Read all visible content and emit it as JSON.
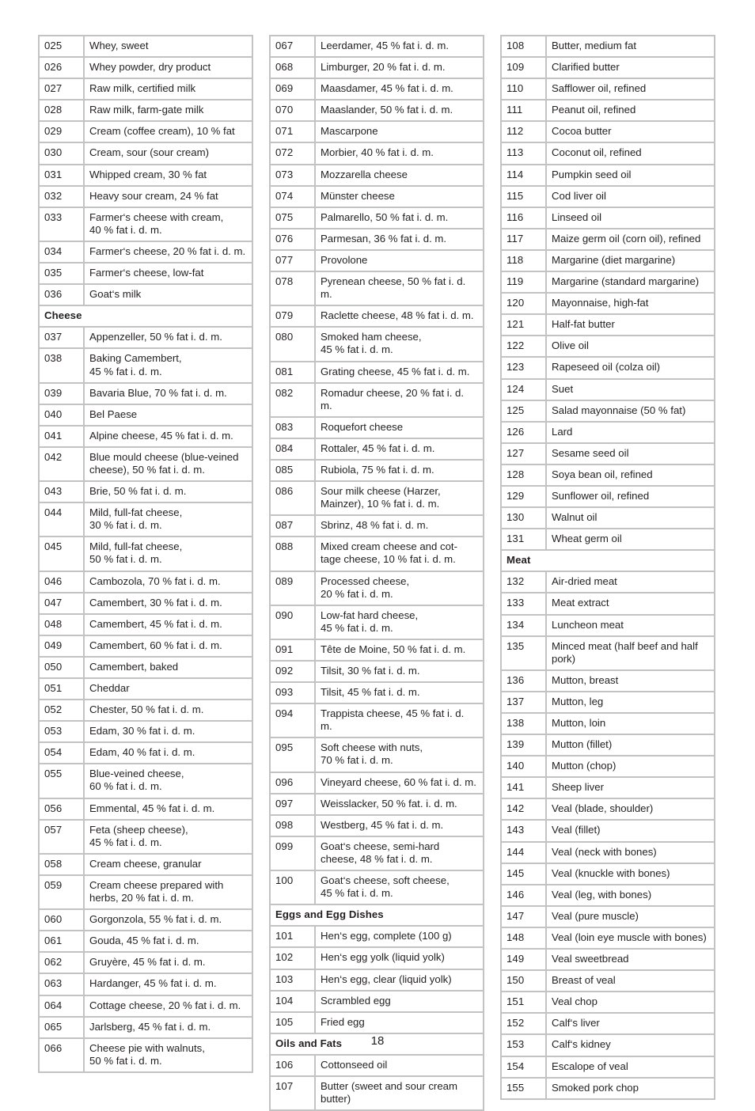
{
  "page": {
    "number": "18",
    "columns": [
      {
        "rows": [
          {
            "type": "item",
            "id": "025",
            "name": "Whey, sweet"
          },
          {
            "type": "item",
            "id": "026",
            "name": "Whey powder, dry product"
          },
          {
            "type": "item",
            "id": "027",
            "name": "Raw milk, certified milk"
          },
          {
            "type": "item",
            "id": "028",
            "name": "Raw milk, farm-gate milk"
          },
          {
            "type": "item",
            "id": "029",
            "name": "Cream (coffee cream), 10 % fat"
          },
          {
            "type": "item",
            "id": "030",
            "name": "Cream, sour (sour cream)"
          },
          {
            "type": "item",
            "id": "031",
            "name": "Whipped cream, 30 % fat"
          },
          {
            "type": "item",
            "id": "032",
            "name": "Heavy sour cream, 24 % fat"
          },
          {
            "type": "item",
            "id": "033",
            "name": "Farmer‘s cheese with cream,\n40 % fat i. d. m."
          },
          {
            "type": "item",
            "id": "034",
            "name": "Farmer‘s cheese, 20 % fat i. d. m."
          },
          {
            "type": "item",
            "id": "035",
            "name": "Farmer‘s cheese, low-fat"
          },
          {
            "type": "item",
            "id": "036",
            "name": "Goat‘s milk"
          },
          {
            "type": "section",
            "name": "Cheese"
          },
          {
            "type": "item",
            "id": "037",
            "name": "Appenzeller, 50 % fat i. d. m."
          },
          {
            "type": "item",
            "id": "038",
            "name": "Baking Camembert,\n45 % fat i. d. m."
          },
          {
            "type": "item",
            "id": "039",
            "name": "Bavaria Blue, 70 % fat i. d. m."
          },
          {
            "type": "item",
            "id": "040",
            "name": "Bel Paese"
          },
          {
            "type": "item",
            "id": "041",
            "name": "Alpine cheese, 45 % fat i. d. m."
          },
          {
            "type": "item",
            "id": "042",
            "name": "Blue mould cheese (blue-veined\ncheese), 50 % fat i. d. m."
          },
          {
            "type": "item",
            "id": "043",
            "name": "Brie, 50 % fat i. d. m."
          },
          {
            "type": "item",
            "id": "044",
            "name": "Mild, full-fat cheese,\n30 % fat i. d. m."
          },
          {
            "type": "item",
            "id": "045",
            "name": "Mild, full-fat cheese,\n50 % fat i. d. m."
          },
          {
            "type": "item",
            "id": "046",
            "name": "Cambozola, 70 % fat i. d. m."
          },
          {
            "type": "item",
            "id": "047",
            "name": "Camembert, 30 % fat i. d. m."
          },
          {
            "type": "item",
            "id": "048",
            "name": "Camembert, 45 % fat i. d. m."
          },
          {
            "type": "item",
            "id": "049",
            "name": "Camembert, 60 % fat i. d. m."
          },
          {
            "type": "item",
            "id": "050",
            "name": "Camembert, baked"
          },
          {
            "type": "item",
            "id": "051",
            "name": "Cheddar"
          },
          {
            "type": "item",
            "id": "052",
            "name": "Chester, 50 % fat i. d. m."
          },
          {
            "type": "item",
            "id": "053",
            "name": "Edam, 30 % fat i. d. m."
          },
          {
            "type": "item",
            "id": "054",
            "name": "Edam, 40 % fat i. d. m."
          },
          {
            "type": "item",
            "id": "055",
            "name": "Blue-veined cheese,\n60 % fat i. d. m."
          },
          {
            "type": "item",
            "id": "056",
            "name": "Emmental, 45 % fat i. d. m."
          },
          {
            "type": "item",
            "id": "057",
            "name": "Feta (sheep cheese),\n45 % fat i. d. m."
          },
          {
            "type": "item",
            "id": "058",
            "name": "Cream cheese, granular"
          },
          {
            "type": "item",
            "id": "059",
            "name": "Cream cheese prepared with\nherbs, 20 % fat i. d. m."
          },
          {
            "type": "item",
            "id": "060",
            "name": "Gorgonzola, 55 % fat i. d. m."
          },
          {
            "type": "item",
            "id": "061",
            "name": "Gouda, 45 % fat i. d. m."
          },
          {
            "type": "item",
            "id": "062",
            "name": "Gruyère, 45 % fat i. d. m."
          },
          {
            "type": "item",
            "id": "063",
            "name": "Hardanger, 45 % fat i. d. m."
          },
          {
            "type": "item",
            "id": "064",
            "name": "Cottage cheese, 20 % fat i. d. m."
          },
          {
            "type": "item",
            "id": "065",
            "name": "Jarlsberg, 45 % fat i. d. m."
          },
          {
            "type": "item",
            "id": "066",
            "name": "Cheese pie with walnuts,\n50 % fat i. d. m."
          }
        ]
      },
      {
        "rows": [
          {
            "type": "item",
            "id": "067",
            "name": "Leerdamer, 45 % fat i. d. m."
          },
          {
            "type": "item",
            "id": "068",
            "name": "Limburger, 20 % fat i. d. m."
          },
          {
            "type": "item",
            "id": "069",
            "name": "Maasdamer, 45 % fat i. d. m."
          },
          {
            "type": "item",
            "id": "070",
            "name": "Maaslander, 50 % fat i. d. m."
          },
          {
            "type": "item",
            "id": "071",
            "name": "Mascarpone"
          },
          {
            "type": "item",
            "id": "072",
            "name": "Morbier, 40 % fat i. d. m."
          },
          {
            "type": "item",
            "id": "073",
            "name": "Mozzarella cheese"
          },
          {
            "type": "item",
            "id": "074",
            "name": "Münster cheese"
          },
          {
            "type": "item",
            "id": "075",
            "name": "Palmarello, 50 % fat i. d. m."
          },
          {
            "type": "item",
            "id": "076",
            "name": "Parmesan, 36 % fat i. d. m."
          },
          {
            "type": "item",
            "id": "077",
            "name": "Provolone"
          },
          {
            "type": "item",
            "id": "078",
            "name": "Pyrenean cheese, 50 % fat i. d. m."
          },
          {
            "type": "item",
            "id": "079",
            "name": "Raclette cheese, 48 % fat i. d. m."
          },
          {
            "type": "item",
            "id": "080",
            "name": "Smoked ham cheese,\n45 % fat i. d. m."
          },
          {
            "type": "item",
            "id": "081",
            "name": "Grating cheese, 45 % fat i. d. m."
          },
          {
            "type": "item",
            "id": "082",
            "name": "Romadur cheese, 20 % fat i. d. m."
          },
          {
            "type": "item",
            "id": "083",
            "name": "Roquefort cheese"
          },
          {
            "type": "item",
            "id": "084",
            "name": "Rottaler, 45 % fat i. d. m."
          },
          {
            "type": "item",
            "id": "085",
            "name": "Rubiola, 75 % fat i. d. m."
          },
          {
            "type": "item",
            "id": "086",
            "name": "Sour milk cheese (Harzer,\nMainzer), 10 % fat i. d. m."
          },
          {
            "type": "item",
            "id": "087",
            "name": "Sbrinz, 48 % fat i. d. m."
          },
          {
            "type": "item",
            "id": "088",
            "name": "Mixed cream cheese and cot-\ntage cheese, 10 % fat i. d. m."
          },
          {
            "type": "item",
            "id": "089",
            "name": "Processed cheese,\n20 % fat i. d. m."
          },
          {
            "type": "item",
            "id": "090",
            "name": "Low-fat hard cheese,\n45 % fat i. d. m."
          },
          {
            "type": "item",
            "id": "091",
            "name": "Tête de Moine, 50 % fat i. d. m."
          },
          {
            "type": "item",
            "id": "092",
            "name": "Tilsit, 30 % fat i. d. m."
          },
          {
            "type": "item",
            "id": "093",
            "name": "Tilsit, 45 % fat i. d. m."
          },
          {
            "type": "item",
            "id": "094",
            "name": "Trappista cheese, 45 % fat i. d. m."
          },
          {
            "type": "item",
            "id": "095",
            "name": "Soft cheese with nuts,\n70 % fat i. d. m."
          },
          {
            "type": "item",
            "id": "096",
            "name": "Vineyard cheese, 60 % fat i. d. m."
          },
          {
            "type": "item",
            "id": "097",
            "name": "Weisslacker, 50 % fat. i. d. m."
          },
          {
            "type": "item",
            "id": "098",
            "name": "Westberg, 45 % fat i. d. m."
          },
          {
            "type": "item",
            "id": "099",
            "name": "Goat‘s cheese, semi-hard\ncheese, 48 % fat i. d. m."
          },
          {
            "type": "item",
            "id": "100",
            "name": "Goat‘s cheese, soft cheese,\n45 % fat i. d. m."
          },
          {
            "type": "section",
            "name": "Eggs and Egg Dishes"
          },
          {
            "type": "item",
            "id": "101",
            "name": "Hen‘s egg, complete (100 g)"
          },
          {
            "type": "item",
            "id": "102",
            "name": "Hen‘s egg yolk (liquid yolk)"
          },
          {
            "type": "item",
            "id": "103",
            "name": "Hen‘s egg, clear (liquid yolk)"
          },
          {
            "type": "item",
            "id": "104",
            "name": "Scrambled egg"
          },
          {
            "type": "item",
            "id": "105",
            "name": "Fried egg"
          },
          {
            "type": "section",
            "name": "Oils and Fats"
          },
          {
            "type": "item",
            "id": "106",
            "name": "Cottonseed oil"
          },
          {
            "type": "item",
            "id": "107",
            "name": "Butter (sweet and sour cream\nbutter)"
          }
        ]
      },
      {
        "rows": [
          {
            "type": "item",
            "id": "108",
            "name": "Butter, medium fat"
          },
          {
            "type": "item",
            "id": "109",
            "name": "Clarified butter"
          },
          {
            "type": "item",
            "id": "110",
            "name": "Safflower oil, refined"
          },
          {
            "type": "item",
            "id": "111",
            "name": "Peanut oil, refined"
          },
          {
            "type": "item",
            "id": "112",
            "name": "Cocoa butter"
          },
          {
            "type": "item",
            "id": "113",
            "name": "Coconut oil, refined"
          },
          {
            "type": "item",
            "id": "114",
            "name": "Pumpkin seed oil"
          },
          {
            "type": "item",
            "id": "115",
            "name": "Cod liver oil"
          },
          {
            "type": "item",
            "id": "116",
            "name": "Linseed oil"
          },
          {
            "type": "item",
            "id": "117",
            "name": "Maize germ oil (corn oil), refined"
          },
          {
            "type": "item",
            "id": "118",
            "name": "Margarine (diet margarine)"
          },
          {
            "type": "item",
            "id": "119",
            "name": "Margarine (standard margarine)"
          },
          {
            "type": "item",
            "id": "120",
            "name": "Mayonnaise, high-fat"
          },
          {
            "type": "item",
            "id": "121",
            "name": "Half-fat butter"
          },
          {
            "type": "item",
            "id": "122",
            "name": "Olive oil"
          },
          {
            "type": "item",
            "id": "123",
            "name": "Rapeseed oil (colza oil)"
          },
          {
            "type": "item",
            "id": "124",
            "name": "Suet"
          },
          {
            "type": "item",
            "id": "125",
            "name": "Salad mayonnaise (50 % fat)"
          },
          {
            "type": "item",
            "id": "126",
            "name": "Lard"
          },
          {
            "type": "item",
            "id": "127",
            "name": "Sesame seed oil"
          },
          {
            "type": "item",
            "id": "128",
            "name": "Soya bean oil, refined"
          },
          {
            "type": "item",
            "id": "129",
            "name": "Sunflower oil, refined"
          },
          {
            "type": "item",
            "id": "130",
            "name": "Walnut oil"
          },
          {
            "type": "item",
            "id": "131",
            "name": "Wheat germ oil"
          },
          {
            "type": "section",
            "name": "Meat"
          },
          {
            "type": "item",
            "id": "132",
            "name": "Air-dried meat"
          },
          {
            "type": "item",
            "id": "133",
            "name": "Meat extract"
          },
          {
            "type": "item",
            "id": "134",
            "name": "Luncheon meat"
          },
          {
            "type": "item",
            "id": "135",
            "name": "Minced meat (half beef and half\npork)"
          },
          {
            "type": "item",
            "id": "136",
            "name": "Mutton, breast"
          },
          {
            "type": "item",
            "id": "137",
            "name": "Mutton, leg"
          },
          {
            "type": "item",
            "id": "138",
            "name": "Mutton, loin"
          },
          {
            "type": "item",
            "id": "139",
            "name": "Mutton (fillet)"
          },
          {
            "type": "item",
            "id": "140",
            "name": "Mutton (chop)"
          },
          {
            "type": "item",
            "id": "141",
            "name": "Sheep liver"
          },
          {
            "type": "item",
            "id": "142",
            "name": "Veal (blade, shoulder)"
          },
          {
            "type": "item",
            "id": "143",
            "name": "Veal (fillet)"
          },
          {
            "type": "item",
            "id": "144",
            "name": "Veal (neck with bones)"
          },
          {
            "type": "item",
            "id": "145",
            "name": "Veal (knuckle with bones)"
          },
          {
            "type": "item",
            "id": "146",
            "name": "Veal (leg, with bones)"
          },
          {
            "type": "item",
            "id": "147",
            "name": "Veal (pure muscle)"
          },
          {
            "type": "item",
            "id": "148",
            "name": "Veal (loin eye muscle with bones)"
          },
          {
            "type": "item",
            "id": "149",
            "name": "Veal sweetbread"
          },
          {
            "type": "item",
            "id": "150",
            "name": "Breast of veal"
          },
          {
            "type": "item",
            "id": "151",
            "name": "Veal chop"
          },
          {
            "type": "item",
            "id": "152",
            "name": "Calf‘s liver"
          },
          {
            "type": "item",
            "id": "153",
            "name": "Calf‘s kidney"
          },
          {
            "type": "item",
            "id": "154",
            "name": "Escalope of veal"
          },
          {
            "type": "item",
            "id": "155",
            "name": "Smoked pork chop"
          }
        ]
      }
    ]
  }
}
